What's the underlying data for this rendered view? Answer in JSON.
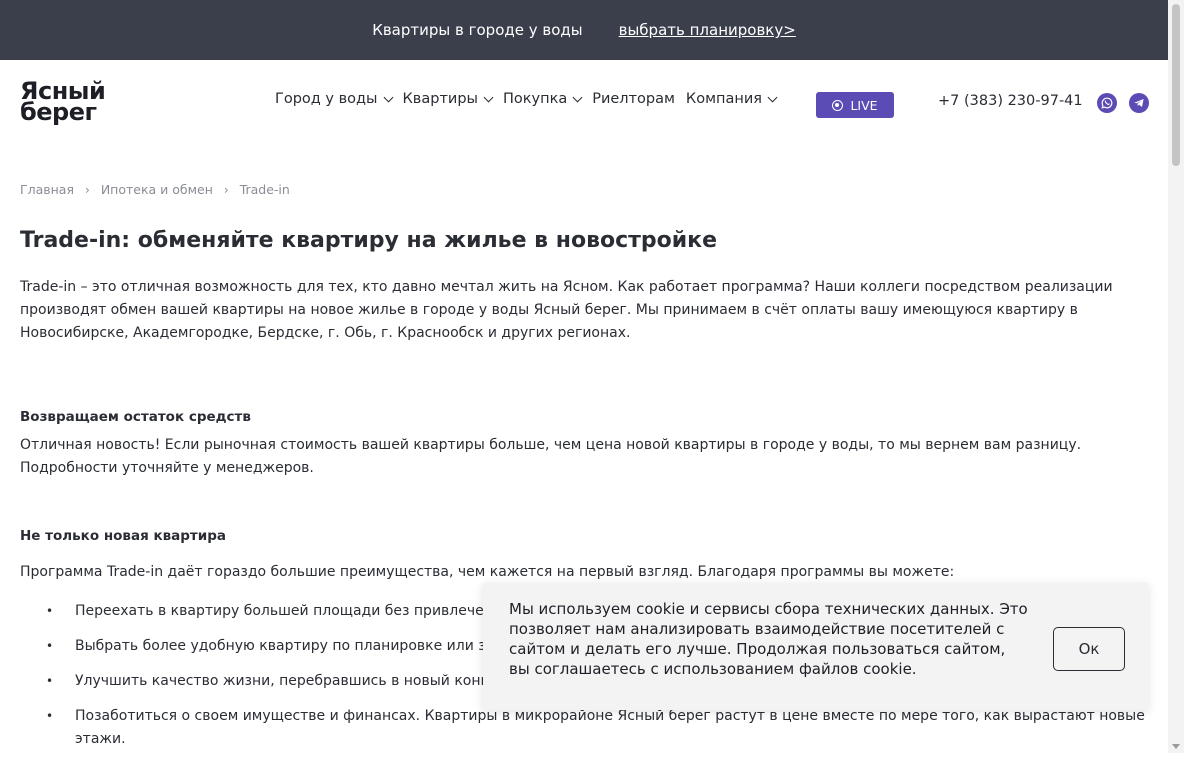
{
  "topbar": {
    "promo": "Квартиры в городе у воды",
    "link": "выбрать планировку>"
  },
  "header": {
    "logo_line1": "Ясный",
    "logo_line2": "берег",
    "nav": [
      {
        "label": "Город у воды",
        "dropdown": true
      },
      {
        "label": "Квартиры",
        "dropdown": true
      },
      {
        "label": "Покупка",
        "dropdown": true
      },
      {
        "label": "Риелторам",
        "dropdown": false
      },
      {
        "label": "Компания",
        "dropdown": true
      }
    ],
    "live_label": "LIVE",
    "phone": "+7 (383) 230-97-41",
    "accent_color": "#5b4bb5"
  },
  "breadcrumb": [
    "Главная",
    "Ипотека и обмен",
    "Trade-in"
  ],
  "title": "Trade-in: обменяйте квартиру на жилье в новостройке",
  "intro": "Trade-in – это отличная возможность для тех, кто давно мечтал жить на Ясном. Как работает программа? Наши коллеги посредством реализации производят обмен вашей квартиры на новое жилье в городе у воды Ясный берег. Мы принимаем в счёт оплаты вашу имеющуюся квартиру в Новосибирске, Академгородке, Бердске, г. Обь, г. Краснообск и других регионах.",
  "section1": {
    "heading": "Возвращаем остаток средств",
    "text": "Отличная новость! Если рыночная стоимость вашей квартиры больше, чем цена новой квартиры в городе у воды, то мы вернем вам разницу. Подробности уточняйте у менеджеров."
  },
  "section2": {
    "heading": "Не только новая квартира",
    "text": "Программа Trade-in даёт гораздо большие преимущества, чем кажется на первый взгляд. Благодаря программы вы можете:",
    "items": [
      "Переехать в квартиру большей площади без привлече",
      "Выбрать более удобную квартиру по планировке или з",
      "Улучшить качество жизни, перебравшись в новый конц",
      "Позаботиться о своем имуществе и финансах. Квартиры в микрорайоне Ясный берег растут в цене вместе по мере того, как вырастают новые этажи."
    ]
  },
  "cookie": {
    "text": "Мы используем cookie и сервисы сбора технических данных. Это позволяет нам анализировать взаимодействие посетителей с сайтом и делать его лучше. Продолжая пользоваться сайтом, вы соглашаетесь с использованием файлов cookie.",
    "ok_label": "Ок"
  }
}
